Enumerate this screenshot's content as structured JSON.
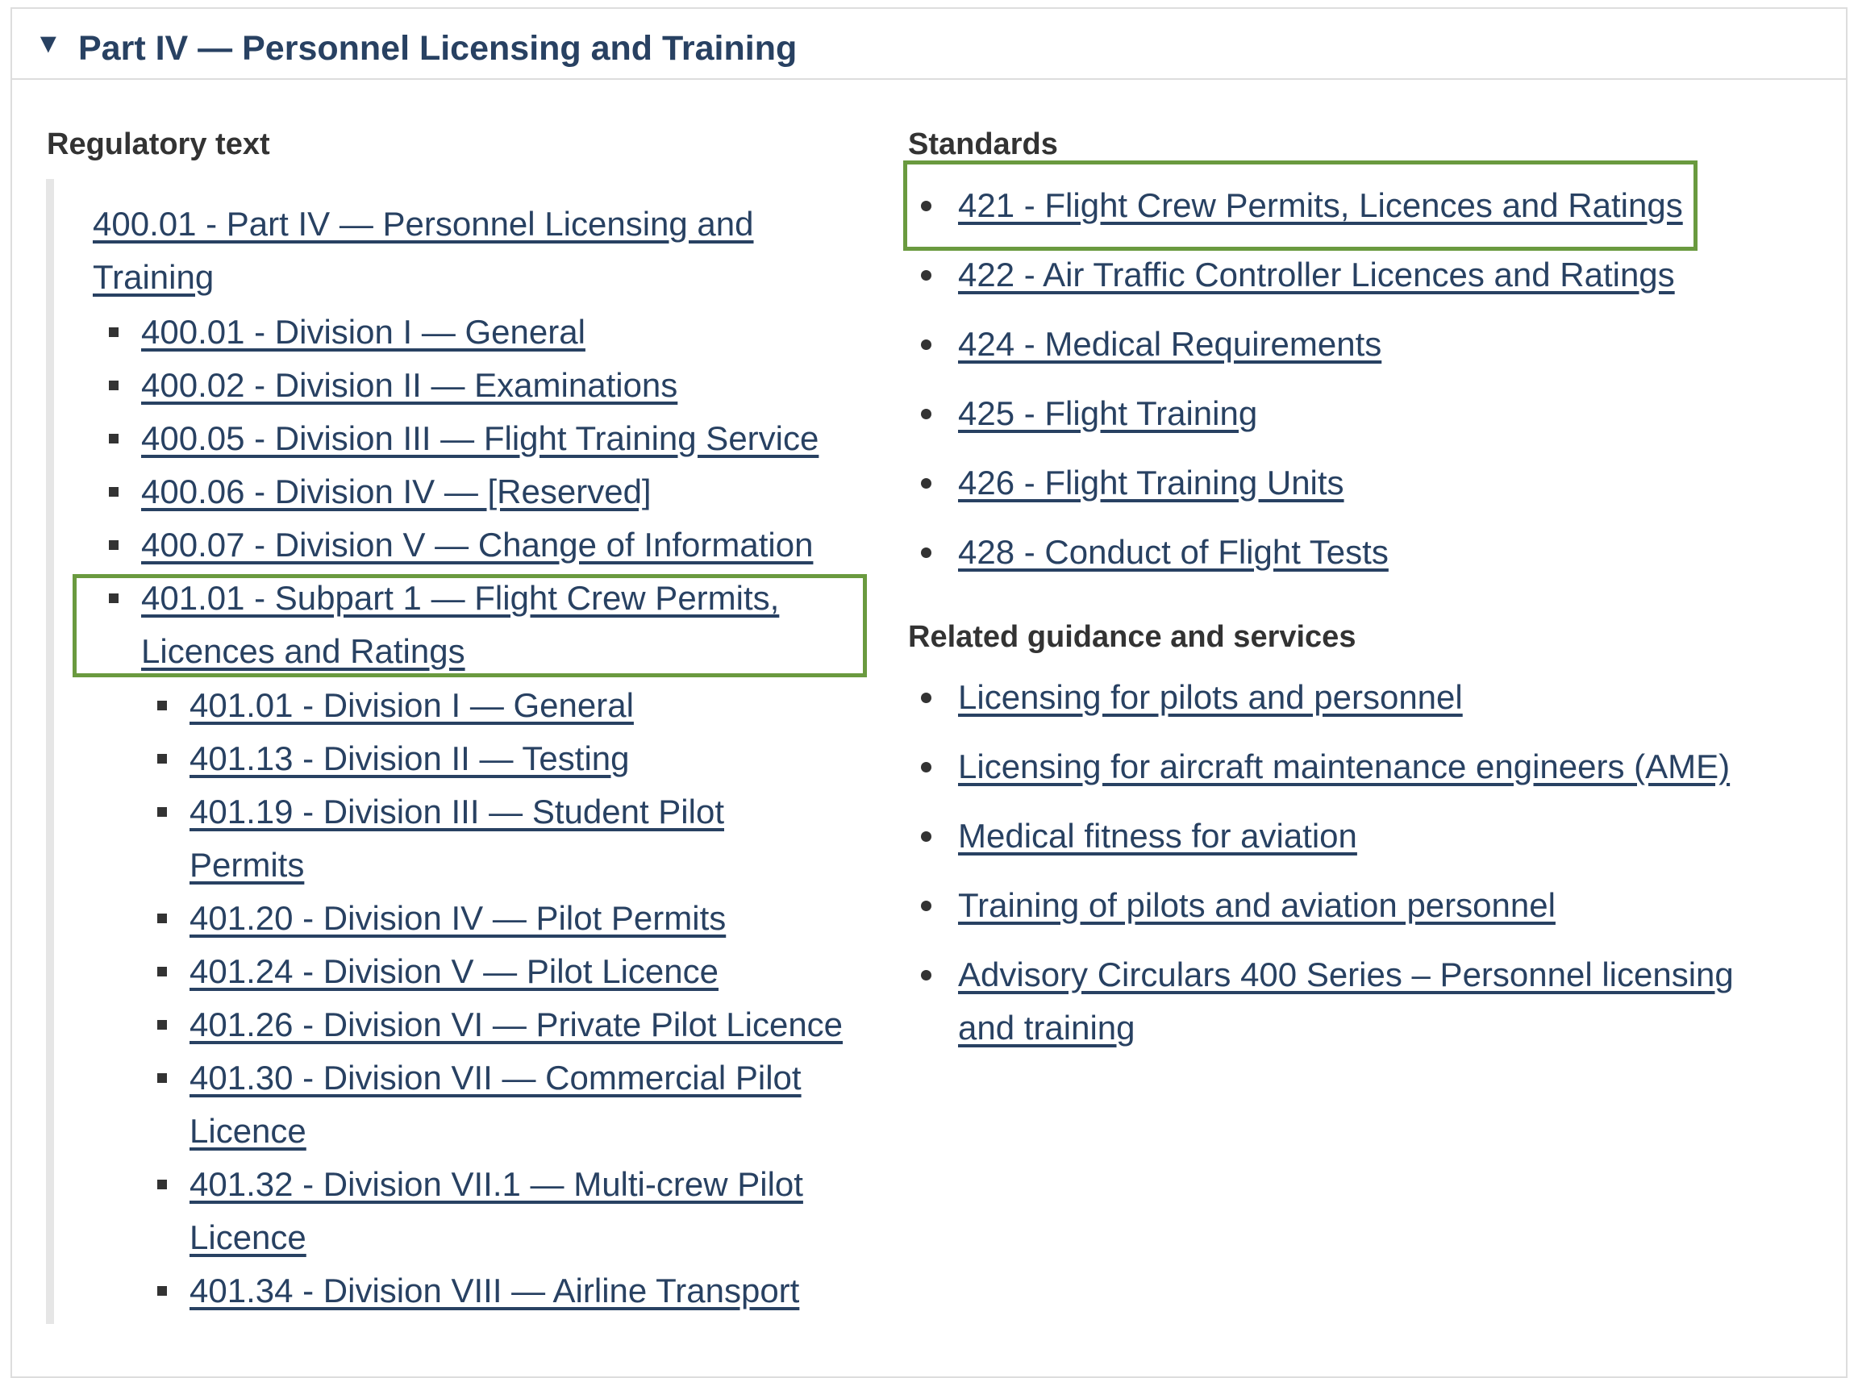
{
  "accordion": {
    "toggle_glyph": "▼",
    "title": "Part IV — Personnel Licensing and Training"
  },
  "regulatory": {
    "heading": "Regulatory text",
    "items": [
      {
        "text": "400.01 - Part IV — Personnel Licensing and Training",
        "level": 0
      },
      {
        "text": "400.01 - Division I — General",
        "level": 1
      },
      {
        "text": "400.02 - Division II — Examinations",
        "level": 1
      },
      {
        "text": "400.05 - Division III — Flight Training Service",
        "level": 1
      },
      {
        "text": "400.06 - Division IV — [Reserved]",
        "level": 1
      },
      {
        "text": "400.07 - Division V — Change of Information",
        "level": 1
      },
      {
        "text": "401.01 - Subpart 1 — Flight Crew Permits, Licences and Ratings",
        "level": 1,
        "highlighted": true
      },
      {
        "text": "401.01 - Division I — General",
        "level": 2
      },
      {
        "text": "401.13 - Division II — Testing",
        "level": 2
      },
      {
        "text": "401.19 - Division III — Student Pilot Permits",
        "level": 2
      },
      {
        "text": "401.20 - Division IV — Pilot Permits",
        "level": 2
      },
      {
        "text": "401.24 - Division V — Pilot Licence",
        "level": 2
      },
      {
        "text": "401.26 - Division VI — Private Pilot Licence",
        "level": 2
      },
      {
        "text": "401.30 - Division VII — Commercial Pilot Licence",
        "level": 2
      },
      {
        "text": "401.32 - Division VII.1 — Multi-crew Pilot Licence",
        "level": 2
      },
      {
        "text": "401.34 - Division VIII — Airline Transport",
        "level": 2
      }
    ]
  },
  "standards": {
    "heading": "Standards",
    "items": [
      {
        "text": "421 - Flight Crew Permits, Licences and Ratings",
        "highlighted": true
      },
      {
        "text": "422 - Air Traffic Controller Licences and Ratings"
      },
      {
        "text": "424 - Medical Requirements"
      },
      {
        "text": "425 - Flight Training"
      },
      {
        "text": "426 - Flight Training Units"
      },
      {
        "text": "428 - Conduct of Flight Tests"
      }
    ]
  },
  "guidance": {
    "heading": "Related guidance and services",
    "items": [
      {
        "text": "Licensing for pilots and personnel"
      },
      {
        "text": "Licensing for aircraft maintenance engineers (AME)"
      },
      {
        "text": "Medical fitness for aviation"
      },
      {
        "text": "Training of pilots and aviation personnel"
      },
      {
        "text": "Advisory Circulars 400 Series – Personnel licensing and training"
      }
    ]
  },
  "colors": {
    "link": "#284162",
    "highlight_border": "#6a9a3f",
    "panel_border": "#dddddd"
  }
}
